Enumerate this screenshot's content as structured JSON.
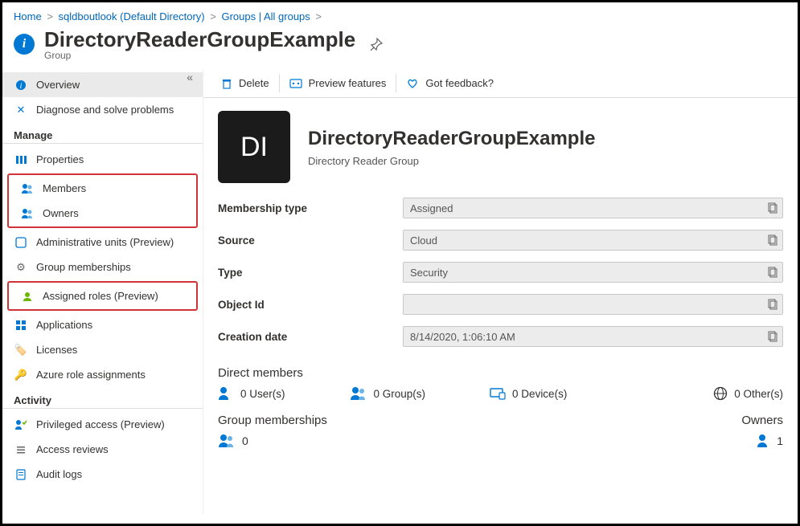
{
  "breadcrumbs": [
    {
      "label": "Home"
    },
    {
      "label": "sqldboutlook (Default Directory)"
    },
    {
      "label": "Groups | All groups"
    }
  ],
  "header": {
    "title": "DirectoryReaderGroupExample",
    "subtitle": "Group"
  },
  "commandbar": {
    "delete": "Delete",
    "preview": "Preview features",
    "feedback": "Got feedback?"
  },
  "sidebar": {
    "overview": "Overview",
    "diagnose": "Diagnose and solve problems",
    "manage_heading": "Manage",
    "properties": "Properties",
    "members": "Members",
    "owners": "Owners",
    "admin_units": "Administrative units (Preview)",
    "group_memberships": "Group memberships",
    "assigned_roles": "Assigned roles (Preview)",
    "applications": "Applications",
    "licenses": "Licenses",
    "azure_roles": "Azure role assignments",
    "activity_heading": "Activity",
    "privileged": "Privileged access (Preview)",
    "access_reviews": "Access reviews",
    "audit_logs": "Audit logs"
  },
  "hero": {
    "initials": "DI",
    "name": "DirectoryReaderGroupExample",
    "desc": "Directory Reader Group"
  },
  "properties": {
    "membership_type": {
      "label": "Membership type",
      "value": "Assigned"
    },
    "source": {
      "label": "Source",
      "value": "Cloud"
    },
    "type": {
      "label": "Type",
      "value": "Security"
    },
    "object_id": {
      "label": "Object Id",
      "value": ""
    },
    "creation_date": {
      "label": "Creation date",
      "value": "8/14/2020, 1:06:10 AM"
    }
  },
  "direct_members": {
    "heading": "Direct members",
    "users": "0 User(s)",
    "groups": "0 Group(s)",
    "devices": "0 Device(s)",
    "others": "0 Other(s)"
  },
  "memberships": {
    "heading": "Group memberships",
    "count": "0"
  },
  "owners": {
    "heading": "Owners",
    "count": "1"
  }
}
